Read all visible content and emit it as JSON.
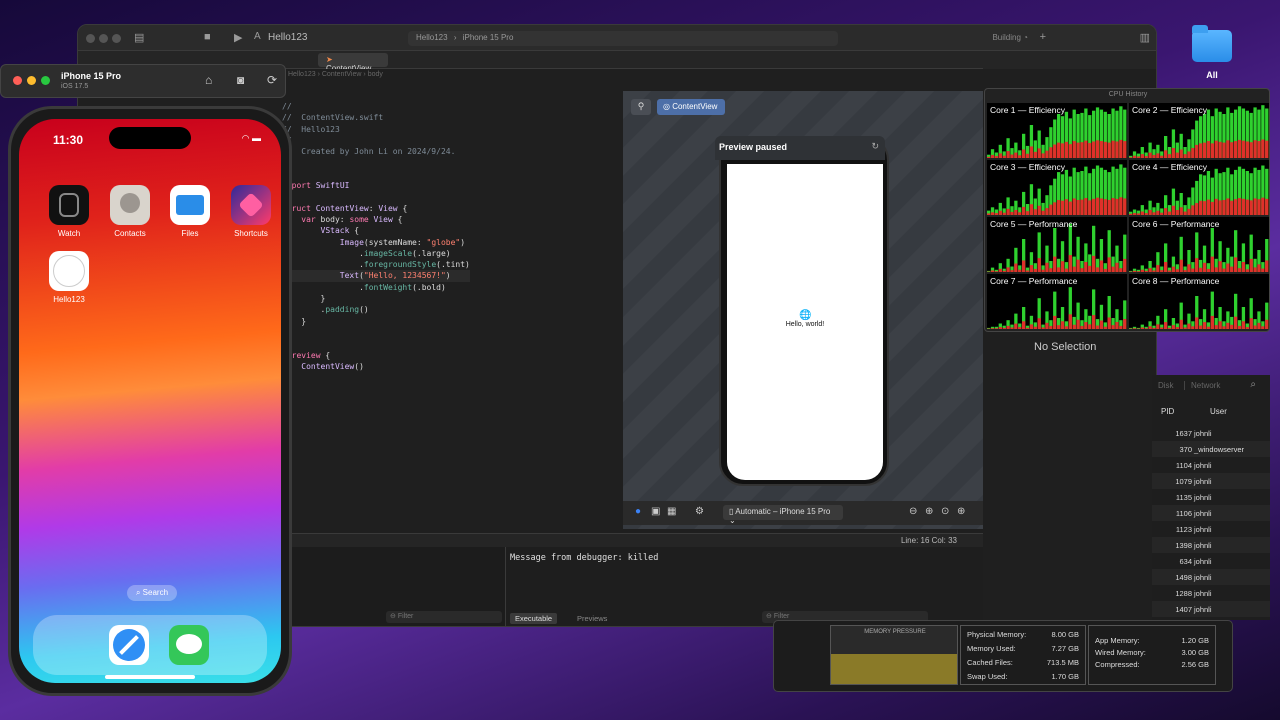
{
  "desktop": {
    "folder_label": "All"
  },
  "xcode": {
    "app_name": "Hello123",
    "scheme_project": "Hello123",
    "scheme_device": "iPhone 15 Pro",
    "status": "Building",
    "tab_label": "ContentView",
    "jump": {
      "project": "Hello123",
      "file": "ContentView",
      "symbol": "body"
    },
    "code_lines": [
      "//",
      "//  ContentView.swift",
      "//  Hello123",
      "//",
      "//  Created by John Li on 2024/9/24.",
      "//",
      "",
      "import SwiftUI",
      "",
      "struct ContentView: View {",
      "    var body: some View {",
      "        VStack {",
      "            Image(systemName: \"globe\")",
      "                .imageScale(.large)",
      "                .foregroundStyle(.tint)",
      "            Text(\"Hello, 1234567!\")",
      "                .fontWeight(.bold)",
      "        }",
      "        .padding()",
      "    }",
      "}",
      "",
      "#Preview {",
      "    ContentView()",
      "}"
    ],
    "canvas": {
      "chip_label": "ContentView",
      "preview_status": "Preview paused",
      "preview_text": "Hello, world!",
      "device_select": "Automatic – iPhone 15 Pro"
    },
    "cursor_position": "Line: 16  Col: 33",
    "debug": {
      "console_message": "Message from debugger: killed",
      "filter_placeholder": "Filter",
      "tab_executable": "Executable",
      "tab_previews": "Previews"
    }
  },
  "cpu_history": {
    "title": "CPU History",
    "cores": [
      {
        "label": "Core 1 — Efficiency",
        "bars": [
          3,
          8,
          5,
          12,
          6,
          18,
          9,
          14,
          7,
          22,
          11,
          30,
          16,
          25,
          12,
          19,
          28,
          35,
          40,
          38,
          42,
          36,
          44,
          40,
          41,
          45,
          39,
          43,
          46,
          44,
          42,
          40,
          45,
          43,
          47,
          44
        ]
      },
      {
        "label": "Core 2 — Efficiency",
        "bars": [
          2,
          6,
          4,
          10,
          5,
          14,
          8,
          12,
          6,
          20,
          10,
          26,
          14,
          22,
          10,
          17,
          26,
          34,
          38,
          40,
          44,
          38,
          45,
          42,
          40,
          46,
          41,
          44,
          47,
          45,
          43,
          41,
          46,
          44,
          48,
          45
        ]
      },
      {
        "label": "Core 3 — Efficiency",
        "bars": [
          4,
          7,
          5,
          11,
          6,
          16,
          8,
          13,
          7,
          21,
          10,
          28,
          15,
          24,
          11,
          18,
          27,
          33,
          39,
          37,
          41,
          35,
          43,
          39,
          40,
          44,
          38,
          42,
          45,
          43,
          41,
          39,
          44,
          42,
          46,
          43
        ]
      },
      {
        "label": "Core 4 — Efficiency",
        "bars": [
          3,
          5,
          4,
          9,
          5,
          13,
          7,
          11,
          6,
          18,
          9,
          24,
          13,
          20,
          9,
          16,
          25,
          31,
          37,
          36,
          40,
          34,
          42,
          38,
          39,
          43,
          37,
          41,
          44,
          42,
          40,
          38,
          43,
          41,
          45,
          42
        ]
      },
      {
        "label": "Core 5 — Performance",
        "bars": [
          1,
          4,
          2,
          8,
          3,
          12,
          5,
          22,
          6,
          30,
          4,
          18,
          8,
          36,
          6,
          24,
          10,
          40,
          12,
          28,
          9,
          44,
          14,
          32,
          10,
          26,
          16,
          42,
          12,
          30,
          8,
          38,
          14,
          24,
          10,
          34
        ]
      },
      {
        "label": "Core 6 — Performance",
        "bars": [
          1,
          3,
          2,
          6,
          3,
          10,
          4,
          18,
          5,
          26,
          4,
          14,
          7,
          32,
          5,
          20,
          9,
          36,
          11,
          24,
          8,
          40,
          12,
          28,
          9,
          22,
          14,
          38,
          10,
          26,
          7,
          34,
          12,
          20,
          9,
          30
        ]
      },
      {
        "label": "Core 7 — Performance",
        "bars": [
          1,
          2,
          2,
          5,
          3,
          8,
          4,
          14,
          5,
          20,
          3,
          12,
          6,
          28,
          4,
          16,
          8,
          34,
          10,
          20,
          7,
          38,
          11,
          24,
          8,
          18,
          12,
          36,
          9,
          22,
          6,
          30,
          10,
          18,
          8,
          26
        ]
      },
      {
        "label": "Core 8 — Performance",
        "bars": [
          1,
          2,
          1,
          4,
          2,
          7,
          3,
          12,
          4,
          18,
          3,
          10,
          5,
          24,
          4,
          14,
          7,
          30,
          9,
          18,
          6,
          34,
          10,
          20,
          7,
          16,
          11,
          32,
          8,
          20,
          5,
          28,
          9,
          16,
          7,
          24
        ]
      }
    ]
  },
  "activity_monitor": {
    "no_selection": "No Selection",
    "tabs": [
      "Disk",
      "Network"
    ],
    "columns": {
      "pid": "PID",
      "user": "User"
    },
    "processes": [
      {
        "pid": "1637",
        "user": "johnli"
      },
      {
        "pid": "370",
        "user": "_windowserver"
      },
      {
        "pid": "1104",
        "user": "johnli"
      },
      {
        "pid": "1079",
        "user": "johnli"
      },
      {
        "pid": "1135",
        "user": "johnli"
      },
      {
        "pid": "1106",
        "user": "johnli"
      },
      {
        "pid": "1123",
        "user": "johnli"
      },
      {
        "pid": "1398",
        "user": "johnli"
      },
      {
        "pid": "634",
        "user": "johnli"
      },
      {
        "pid": "1498",
        "user": "johnli"
      },
      {
        "pid": "1288",
        "user": "johnli"
      },
      {
        "pid": "1407",
        "user": "johnli"
      }
    ],
    "memory": {
      "pressure_label": "MEMORY PRESSURE",
      "physical_label": "Physical Memory:",
      "physical": "8.00 GB",
      "used_label": "Memory Used:",
      "used": "7.27 GB",
      "cached_label": "Cached Files:",
      "cached": "713.5 MB",
      "swap_label": "Swap Used:",
      "swap": "1.70 GB",
      "app_label": "App Memory:",
      "app": "1.20 GB",
      "wired_label": "Wired Memory:",
      "wired": "3.00 GB",
      "compressed_label": "Compressed:",
      "compressed": "2.56 GB"
    }
  },
  "simulator": {
    "device": "iPhone 15 Pro",
    "os": "iOS 17.5",
    "time": "11:30",
    "apps": [
      {
        "label": "Watch",
        "color": "#111111"
      },
      {
        "label": "Contacts",
        "color": "#d9d4cc"
      },
      {
        "label": "Files",
        "color": "#ffffff"
      },
      {
        "label": "Shortcuts",
        "color": "#3b2a8f"
      },
      {
        "label": "Hello123",
        "color": "#ffffff"
      }
    ],
    "search_label": "Search",
    "dock": [
      "Safari",
      "Messages"
    ]
  }
}
